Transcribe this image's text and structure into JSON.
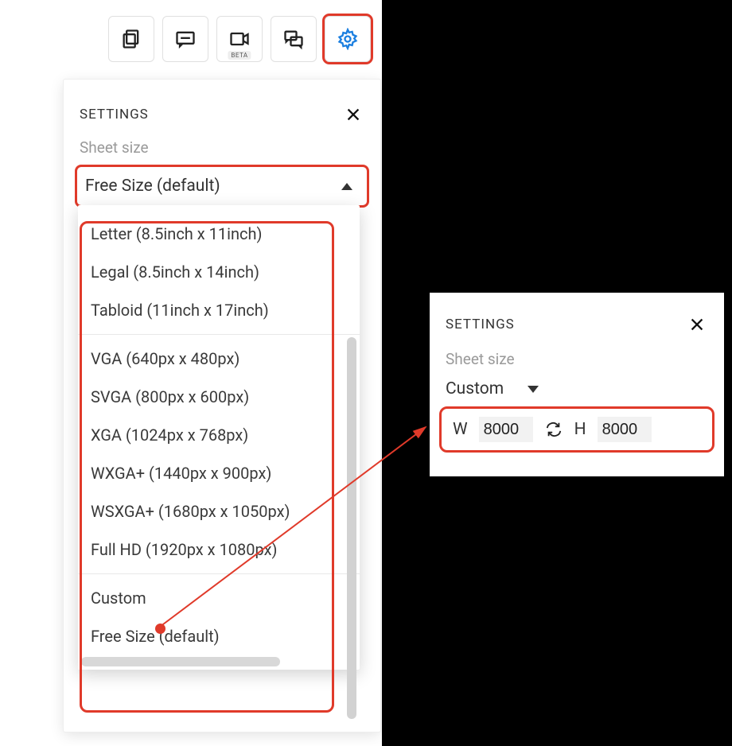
{
  "toolbar": {
    "beta_badge": "BETA"
  },
  "panel": {
    "title": "SETTINGS",
    "sheet_size_label": "Sheet size",
    "selected": "Free Size (default)"
  },
  "dropdown": {
    "groups": [
      [
        "Letter (8.5inch x 11inch)",
        "Legal (8.5inch x 14inch)",
        "Tabloid (11inch x 17inch)"
      ],
      [
        "VGA (640px x 480px)",
        "SVGA (800px x 600px)",
        "XGA (1024px x 768px)",
        "WXGA+ (1440px x 900px)",
        "WSXGA+ (1680px x 1050px)",
        "Full HD (1920px x 1080px)"
      ],
      [
        "Custom",
        "Free Size (default)"
      ]
    ]
  },
  "custom_panel": {
    "title": "SETTINGS",
    "sheet_size_label": "Sheet size",
    "selected": "Custom",
    "w_label": "W",
    "w_value": "8000",
    "h_label": "H",
    "h_value": "8000"
  }
}
